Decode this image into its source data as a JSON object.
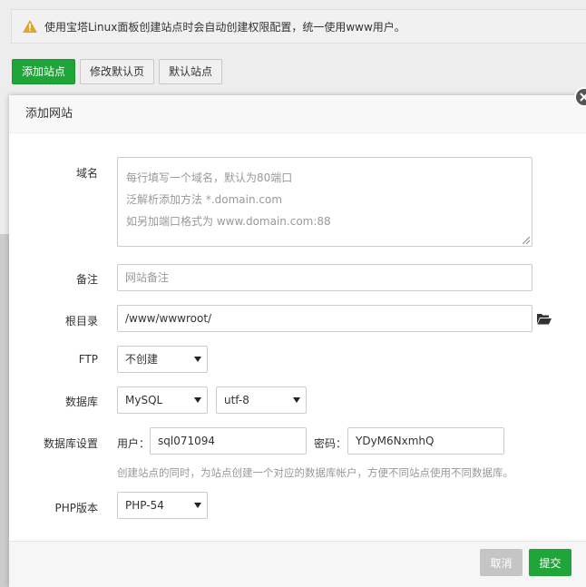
{
  "notice": {
    "icon": "warning-icon",
    "text": "使用宝塔Linux面板创建站点时会自动创建权限配置，统一使用www用户。"
  },
  "toolbar": {
    "add_site": "添加站点",
    "edit_default_page": "修改默认页",
    "default_site": "默认站点"
  },
  "modal": {
    "title": "添加网站",
    "domain": {
      "label": "域名",
      "placeholder_lines": [
        "每行填写一个域名，默认为80端口",
        "泛解析添加方法 *.domain.com",
        "如另加端口格式为 www.domain.com:88"
      ]
    },
    "remark": {
      "label": "备注",
      "placeholder": "网站备注"
    },
    "root": {
      "label": "根目录",
      "value": "/www/wwwroot/",
      "icon": "folder-open-icon"
    },
    "ftp": {
      "label": "FTP",
      "value": "不创建"
    },
    "database": {
      "label": "数据库",
      "type": "MySQL",
      "charset": "utf-8"
    },
    "db_settings": {
      "label": "数据库设置",
      "user_label": "用户：",
      "user_value": "sql071094",
      "password_label": "密码：",
      "password_value": "YDyM6NxmhQ",
      "hint": "创建站点的同时，为站点创建一个对应的数据库帐户，方便不同站点使用不同数据库。"
    },
    "php": {
      "label": "PHP版本",
      "value": "PHP-54"
    },
    "footer": {
      "cancel": "取消",
      "submit": "提交"
    }
  },
  "colors": {
    "accent": "#20a53a",
    "cancel": "#c5c5c5"
  }
}
